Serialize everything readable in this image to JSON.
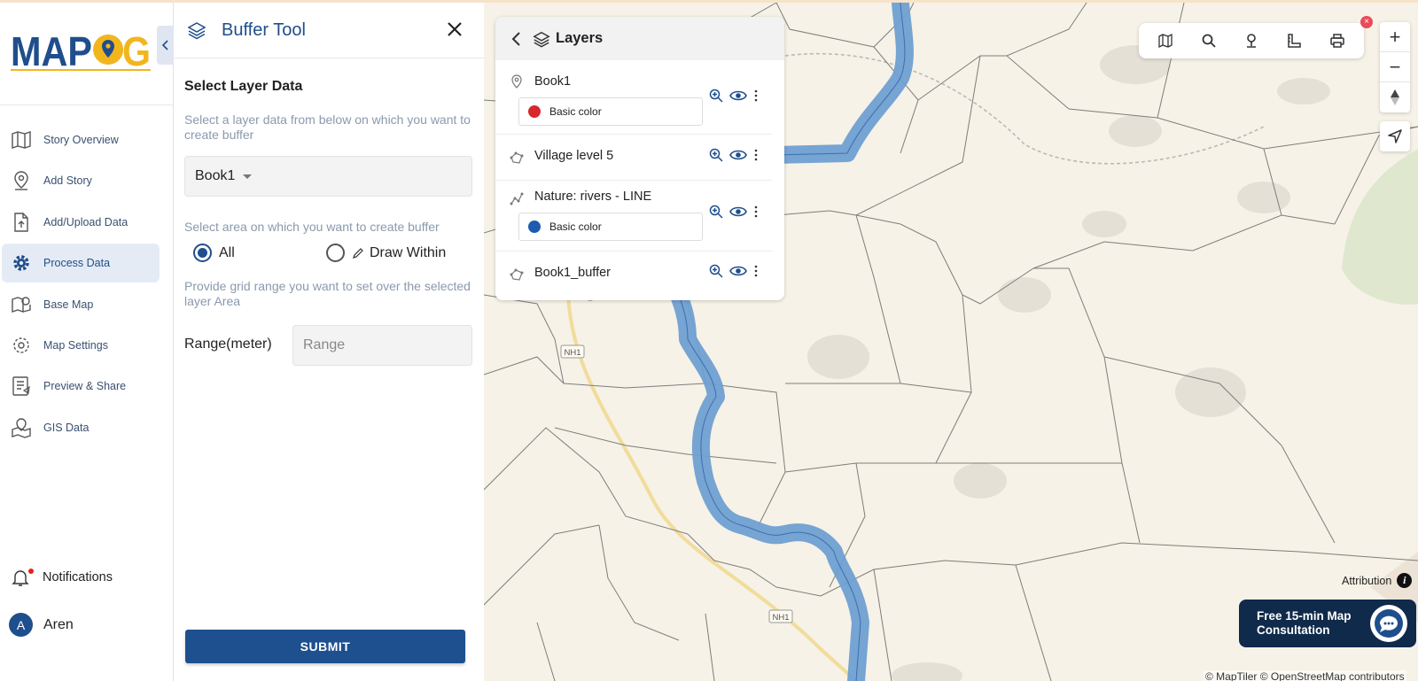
{
  "app": {
    "logo_text": "MAPOG"
  },
  "sidebar": {
    "items": [
      {
        "label": "Story Overview",
        "icon": "map-icon"
      },
      {
        "label": "Add Story",
        "icon": "location-pin-icon"
      },
      {
        "label": "Add/Upload Data",
        "icon": "file-upload-icon"
      },
      {
        "label": "Process Data",
        "icon": "gear-icon",
        "active": true
      },
      {
        "label": "Base Map",
        "icon": "base-map-icon"
      },
      {
        "label": "Map Settings",
        "icon": "settings-icon"
      },
      {
        "label": "Preview & Share",
        "icon": "preview-icon"
      },
      {
        "label": "GIS Data",
        "icon": "gis-data-icon"
      }
    ],
    "notifications_label": "Notifications",
    "user": {
      "initial": "A",
      "name": "Aren"
    }
  },
  "buffer_tool": {
    "title": "Buffer Tool",
    "section_title": "Select Layer Data",
    "layer_help": "Select a layer data from below on which you want to create buffer",
    "selected_layer": "Book1",
    "area_help": "Select area on which you want to create buffer",
    "option_all": "All",
    "option_draw": "Draw Within",
    "grid_help": "Provide grid range you want to set over the selected layer Area",
    "range_label": "Range(meter)",
    "range_placeholder": "Range",
    "submit_label": "SUBMIT"
  },
  "layers_panel": {
    "title": "Layers",
    "layers": [
      {
        "name": "Book1",
        "style": "Basic color",
        "color": "#d9262c",
        "type_icon": "point-icon"
      },
      {
        "name": "Village level 5",
        "type_icon": "polygon-icon"
      },
      {
        "name": "Nature: rivers - LINE",
        "style": "Basic color",
        "color": "#1d5bb0",
        "type_icon": "line-icon"
      },
      {
        "name": "Book1_buffer",
        "type_icon": "polygon-icon"
      }
    ]
  },
  "map": {
    "road_labels": [
      "NH1",
      "NH1"
    ],
    "attribution_label": "Attribution",
    "consultation": {
      "line1": "Free 15-min Map",
      "line2": "Consultation"
    },
    "credits": "© MapTiler © OpenStreetMap contributors",
    "colors": {
      "river": "#6f9fd2",
      "land": "#f6f2e7",
      "road": "#f1dc9a",
      "accent": "#1f4e8c"
    }
  }
}
